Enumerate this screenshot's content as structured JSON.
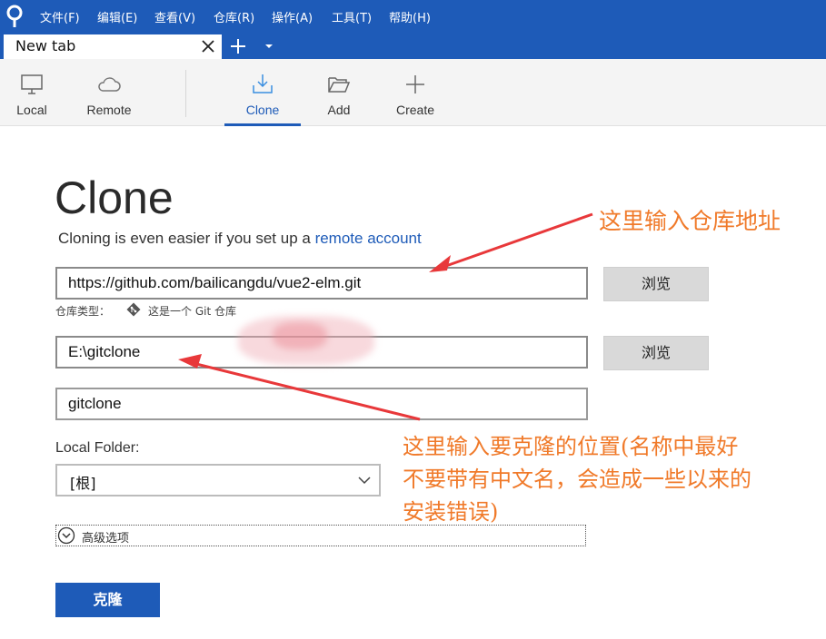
{
  "menubar": {
    "items": [
      "文件(F)",
      "编辑(E)",
      "查看(V)",
      "仓库(R)",
      "操作(A)",
      "工具(T)",
      "帮助(H)"
    ]
  },
  "tabs": {
    "active_label": "New tab"
  },
  "toolbar": {
    "items": [
      {
        "label": "Local",
        "icon": "monitor-icon"
      },
      {
        "label": "Remote",
        "icon": "cloud-icon"
      },
      {
        "label": "Clone",
        "icon": "download-icon"
      },
      {
        "label": "Add",
        "icon": "folder-open-icon"
      },
      {
        "label": "Create",
        "icon": "plus-icon"
      }
    ],
    "active": "Clone"
  },
  "main": {
    "title": "Clone",
    "subtitle_prefix": "Cloning is even easier if you set up a ",
    "subtitle_link": "remote account",
    "source_url": "https://github.com/bailicangdu/vue2-elm.git",
    "browse_label": "浏览",
    "repo_type_label": "仓库类型：",
    "repo_type_value": "这是一个 Git 仓库",
    "destination_path": "E:\\gitclone",
    "name": "gitclone",
    "local_folder_label": "Local Folder:",
    "local_folder_value": "[根]",
    "advanced_label": "高级选项",
    "clone_button": "克隆"
  },
  "annotations": {
    "top": "这里输入仓库地址",
    "bottom_lines": [
      "这里输入要克隆的位置(名称中最好",
      "不要带有中文名，会造成一些以来的",
      "安装错误)"
    ]
  },
  "colors": {
    "brand": "#1e5bb8",
    "annotation": "#f07a2a",
    "arrow": "#e8383a"
  }
}
